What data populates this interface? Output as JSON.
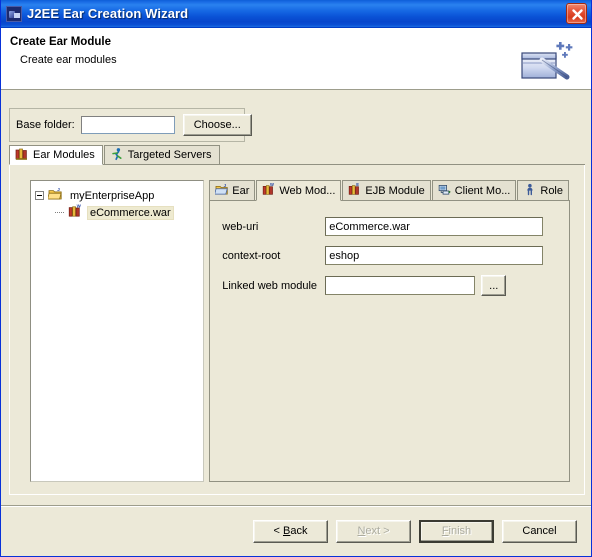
{
  "window": {
    "title": "J2EE Ear Creation Wizard",
    "icon": "app-icon",
    "close_label": "×"
  },
  "header": {
    "title": "Create Ear Module",
    "description": "Create ear modules",
    "icon": "wizard-wand-icon"
  },
  "base_folder": {
    "label": "Base folder:",
    "value": "",
    "placeholder": "",
    "choose_label": "Choose..."
  },
  "outer_tabs": [
    {
      "label": "Ear Modules",
      "icon": "books-icon",
      "selected": true
    },
    {
      "label": "Targeted Servers",
      "icon": "runner-icon",
      "selected": false
    }
  ],
  "tree": {
    "root": {
      "label": "myEnterpriseApp",
      "icon": "ear-folder-icon",
      "expanded": true
    },
    "children": [
      {
        "label": "eCommerce.war",
        "icon": "web-module-icon",
        "selected": true
      }
    ]
  },
  "inner_tabs": [
    {
      "label": "Ear",
      "icon": "ear-folder-icon",
      "selected": false
    },
    {
      "label": "Web Mod...",
      "icon": "web-module-icon",
      "selected": true
    },
    {
      "label": "EJB Module",
      "icon": "ejb-module-icon",
      "selected": false
    },
    {
      "label": "Client Mo...",
      "icon": "client-module-icon",
      "selected": false
    },
    {
      "label": "Role",
      "icon": "person-icon",
      "selected": false
    }
  ],
  "form": {
    "web_uri": {
      "label": "web-uri",
      "value": "eCommerce.war"
    },
    "context_root": {
      "label": "context-root",
      "value": "eshop"
    },
    "linked_web_module": {
      "label": "Linked web module",
      "value": "",
      "browse_label": "..."
    }
  },
  "footer": {
    "back": {
      "label": "< Back",
      "enabled": true
    },
    "next": {
      "label": "Next >",
      "enabled": false
    },
    "finish": {
      "label": "Finish",
      "enabled": false,
      "default": true
    },
    "cancel": {
      "label": "Cancel",
      "enabled": true
    }
  },
  "colors": {
    "title_bar": "#0a52d6",
    "dialog_bg": "#ece9d8",
    "close_button": "#d63b1c",
    "tree_selection": "#eeead0",
    "header_bg": "#ffffff"
  }
}
